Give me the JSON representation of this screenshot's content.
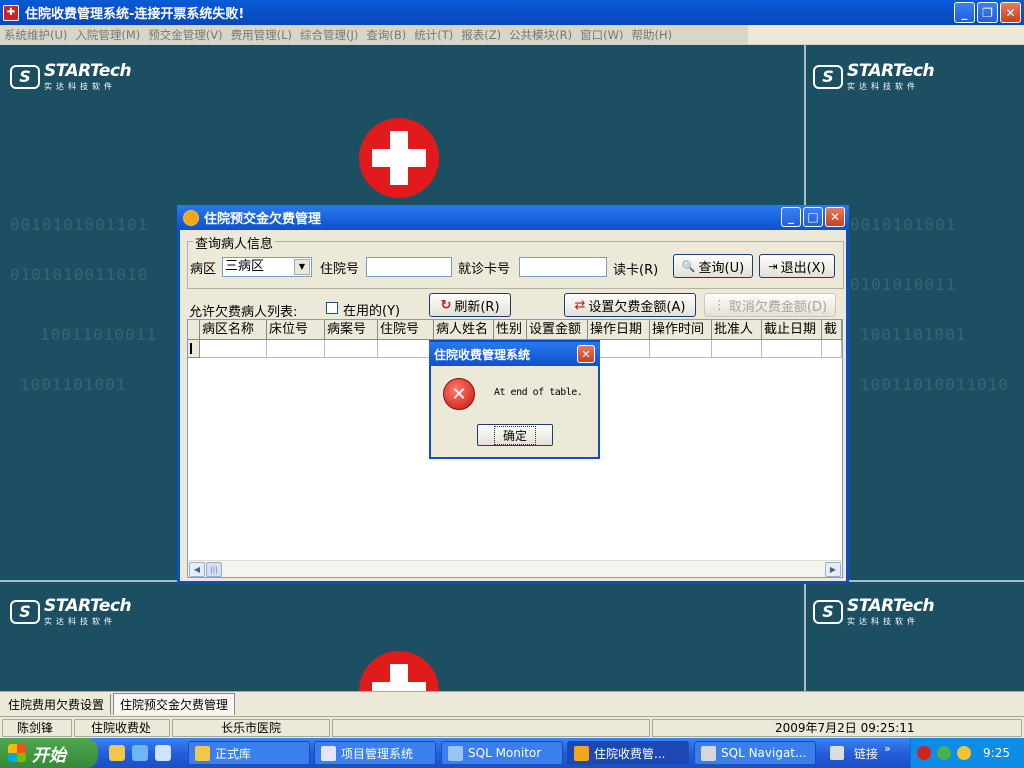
{
  "window": {
    "title": "住院收费管理系统-连接开票系统失败!",
    "icon": "hospital-app-icon"
  },
  "menu": [
    "系统维护(U)",
    "入院管理(M)",
    "预交金管理(V)",
    "费用管理(L)",
    "综合管理(J)",
    "查询(B)",
    "统计(T)",
    "报表(Z)",
    "公共模块(R)",
    "窗口(W)",
    "帮助(H)"
  ],
  "background": {
    "logo_brand": "STARTech",
    "logo_sub": "实达科技软件",
    "logo_mark": "S"
  },
  "dialog": {
    "title": "住院预交金欠费管理",
    "group_legend": "查询病人信息",
    "ward_label": "病区",
    "ward_value": "三病区",
    "admission_label": "住院号",
    "admission_value": "",
    "card_label": "就诊卡号",
    "card_value": "",
    "read_card": "读卡(R)",
    "query_button": "查询(U)",
    "exit_button": "退出(X)",
    "list_label": "允许欠费病人列表:",
    "in_use_label": "在用的(Y)",
    "in_use_checked": false,
    "refresh_button": "刷新(R)",
    "set_amount_button": "设置欠费金额(A)",
    "cancel_amount_button": "取消欠费金额(D)",
    "columns": [
      "病区名称",
      "床位号",
      "病案号",
      "住院号",
      "病人姓名",
      "性别",
      "设置金额",
      "操作日期",
      "操作时间",
      "批准人",
      "截止日期",
      "截"
    ]
  },
  "message_box": {
    "title": "住院收费管理系统",
    "text": "At end of table.",
    "ok_button": "确定"
  },
  "mdi_tabs": [
    {
      "label": "住院费用欠费设置",
      "active": false
    },
    {
      "label": "住院预交金欠费管理",
      "active": true
    }
  ],
  "status_bar": {
    "user": "陈剑锋",
    "department": "住院收费处",
    "hospital": "长乐市医院",
    "datetime": "2009年7月2日 09:25:11"
  },
  "taskbar": {
    "start_label": "开始",
    "tasks": [
      {
        "label": "正式库",
        "active": false
      },
      {
        "label": "项目管理系统",
        "active": false
      },
      {
        "label": "SQL Monitor",
        "active": false
      },
      {
        "label": "住院收费管...",
        "active": true
      },
      {
        "label": "SQL Navigat...",
        "active": false
      }
    ],
    "links_label": "链接",
    "clock": "9:25"
  }
}
